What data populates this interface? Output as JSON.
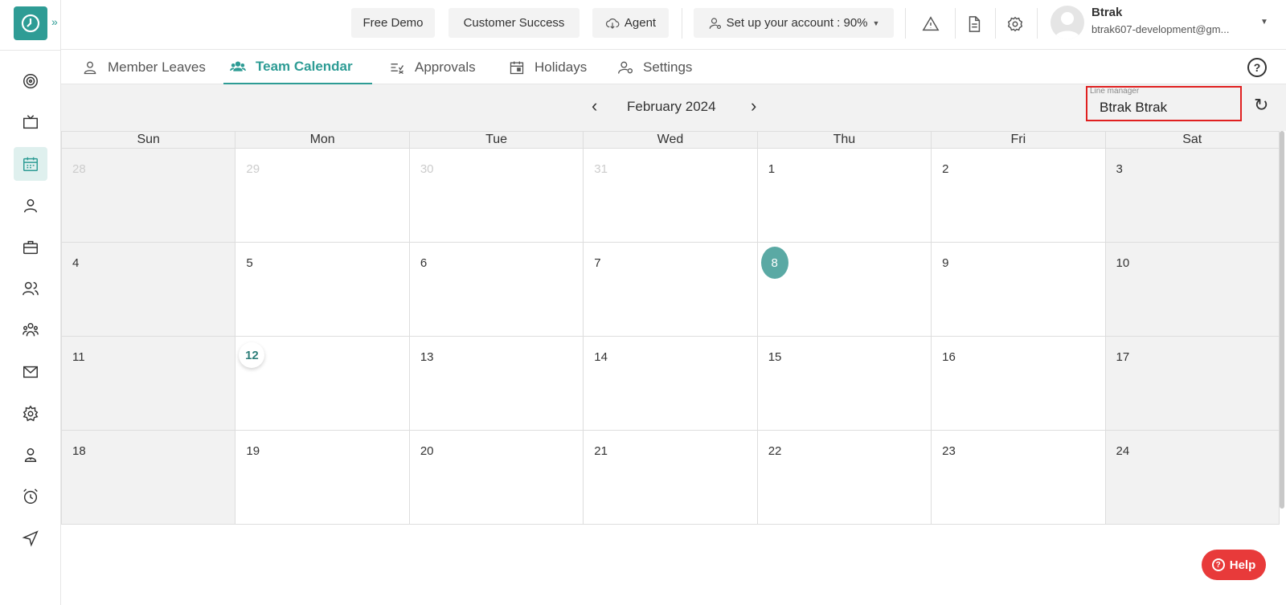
{
  "sidebar": {
    "expand_icon": "»",
    "icons": [
      "target-icon",
      "tv-icon",
      "calendar-icon",
      "user-icon",
      "briefcase-icon",
      "users-icon",
      "team-icon",
      "mail-icon",
      "gear-icon",
      "badge-icon",
      "alarm-icon",
      "send-icon"
    ],
    "active_index": 2
  },
  "topbar": {
    "free_demo": "Free Demo",
    "customer_success": "Customer Success",
    "agent": "Agent",
    "setup": "Set up your account : 90%",
    "user_name": "Btrak",
    "user_email": "btrak607-development@gm..."
  },
  "tabs": [
    {
      "label": "Member Leaves"
    },
    {
      "label": "Team Calendar",
      "active": true
    },
    {
      "label": "Approvals"
    },
    {
      "label": "Holidays"
    },
    {
      "label": "Settings"
    }
  ],
  "calendar": {
    "month_label": "February 2024",
    "line_manager_label": "Line manager",
    "line_manager_value": "Btrak Btrak",
    "days_of_week": [
      "Sun",
      "Mon",
      "Tue",
      "Wed",
      "Thu",
      "Fri",
      "Sat"
    ],
    "weeks": [
      [
        "28",
        "29",
        "30",
        "31",
        "1",
        "2",
        "3"
      ],
      [
        "4",
        "5",
        "6",
        "7",
        "8",
        "9",
        "10"
      ],
      [
        "11",
        "12",
        "13",
        "14",
        "15",
        "16",
        "17"
      ],
      [
        "18",
        "19",
        "20",
        "21",
        "22",
        "23",
        "24"
      ]
    ],
    "today": "8",
    "selected": "12"
  },
  "help_button": "Help",
  "colors": {
    "accent": "#2e9c95",
    "highlight_border": "#e02020",
    "help": "#e83a3a"
  }
}
